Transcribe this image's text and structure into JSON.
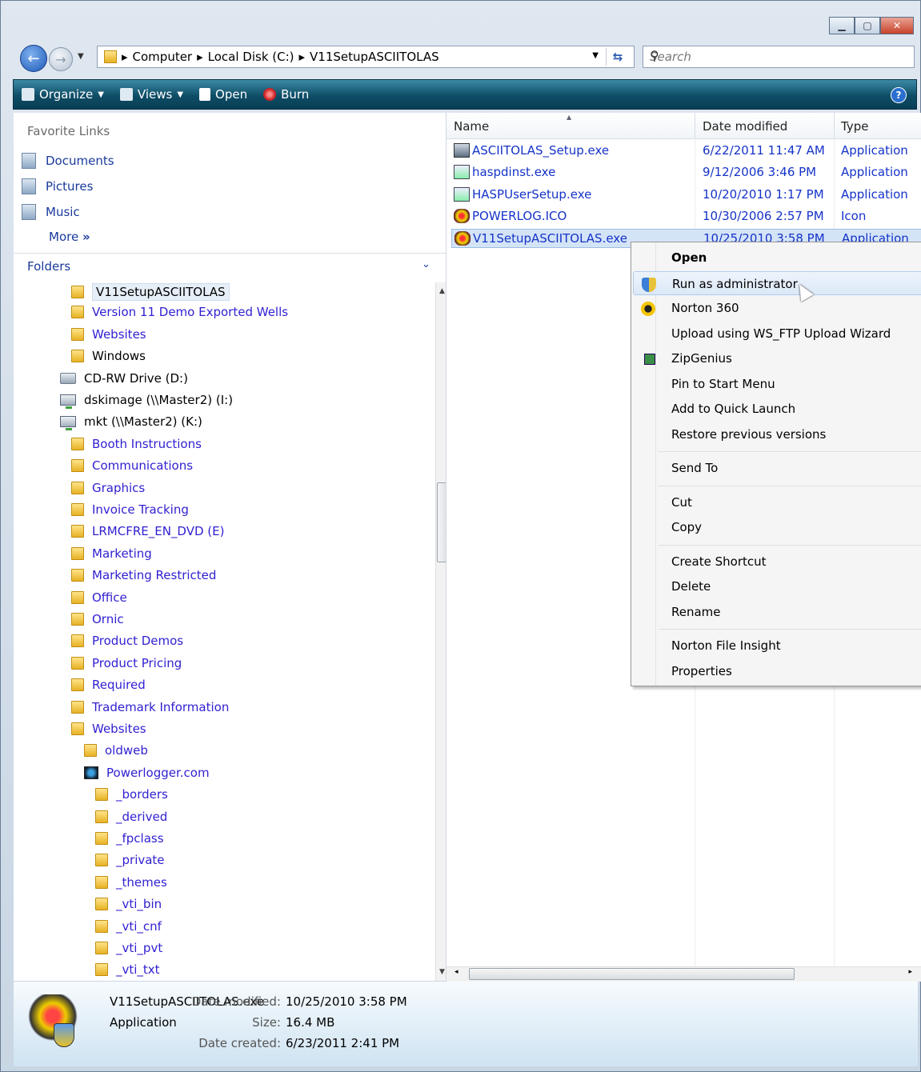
{
  "address": {
    "crumbs": [
      "Computer",
      "Local Disk (C:)",
      "V11SetupASCIITOLAS"
    ],
    "search_placeholder": "Search"
  },
  "toolbar": {
    "organize": "Organize",
    "views": "Views",
    "open": "Open",
    "burn": "Burn"
  },
  "favorites": {
    "title": "Favorite Links",
    "items": [
      "Documents",
      "Pictures",
      "Music"
    ],
    "more": "More"
  },
  "folders": {
    "title": "Folders",
    "items": [
      {
        "label": "V11SetupASCIITOLAS",
        "icon": "folder-icon",
        "indent": 0,
        "selected": true
      },
      {
        "label": "Version 11 Demo Exported Wells",
        "icon": "folder-icon",
        "indent": 0
      },
      {
        "label": "Websites",
        "icon": "folder-icon",
        "indent": 0
      },
      {
        "label": "Windows",
        "icon": "folder-icon",
        "indent": 0
      },
      {
        "label": "CD-RW Drive (D:)",
        "icon": "cd-drive-icon",
        "indent": -1
      },
      {
        "label": "dskimage (\\\\Master2) (I:)",
        "icon": "network-drive-icon",
        "indent": -1
      },
      {
        "label": "mkt (\\\\Master2) (K:)",
        "icon": "network-drive-icon",
        "indent": -1
      },
      {
        "label": "Booth Instructions",
        "icon": "folder-icon",
        "indent": 0
      },
      {
        "label": "Communications",
        "icon": "folder-icon",
        "indent": 0
      },
      {
        "label": "Graphics",
        "icon": "folder-icon",
        "indent": 0
      },
      {
        "label": "Invoice Tracking",
        "icon": "folder-icon",
        "indent": 0
      },
      {
        "label": "LRMCFRE_EN_DVD (E)",
        "icon": "folder-icon",
        "indent": 0
      },
      {
        "label": "Marketing",
        "icon": "folder-icon",
        "indent": 0
      },
      {
        "label": "Marketing Restricted",
        "icon": "folder-icon",
        "indent": 0
      },
      {
        "label": "Office",
        "icon": "folder-icon",
        "indent": 0
      },
      {
        "label": "Ornic",
        "icon": "folder-icon",
        "indent": 0
      },
      {
        "label": "Product Demos",
        "icon": "folder-icon",
        "indent": 0
      },
      {
        "label": "Product Pricing",
        "icon": "folder-icon",
        "indent": 0
      },
      {
        "label": "Required",
        "icon": "folder-icon",
        "indent": 0
      },
      {
        "label": "Trademark Information",
        "icon": "folder-icon",
        "indent": 0
      },
      {
        "label": "Websites",
        "icon": "folder-icon",
        "indent": 0
      },
      {
        "label": "oldweb",
        "icon": "folder-icon",
        "indent": 1
      },
      {
        "label": "Powerlogger.com",
        "icon": "web-folder-icon",
        "indent": 1
      },
      {
        "label": "_borders",
        "icon": "folder-icon",
        "indent": 2
      },
      {
        "label": "_derived",
        "icon": "folder-icon",
        "indent": 2
      },
      {
        "label": "_fpclass",
        "icon": "folder-icon",
        "indent": 2
      },
      {
        "label": "_private",
        "icon": "folder-icon",
        "indent": 2
      },
      {
        "label": "_themes",
        "icon": "folder-icon",
        "indent": 2
      },
      {
        "label": "_vti_bin",
        "icon": "folder-icon",
        "indent": 2
      },
      {
        "label": "_vti_cnf",
        "icon": "folder-icon",
        "indent": 2
      },
      {
        "label": "_vti_pvt",
        "icon": "folder-icon",
        "indent": 2
      },
      {
        "label": "_vti_txt",
        "icon": "folder-icon",
        "indent": 2
      }
    ]
  },
  "columns": {
    "name": "Name",
    "date": "Date modified",
    "type": "Type"
  },
  "files": [
    {
      "name": "ASCIITOLAS_Setup.exe",
      "date": "6/22/2011 11:47 AM",
      "type": "Application",
      "icon": "setup-icon"
    },
    {
      "name": "haspdinst.exe",
      "date": "9/12/2006 3:46 PM",
      "type": "Application",
      "icon": "installer-icon"
    },
    {
      "name": "HASPUserSetup.exe",
      "date": "10/20/2010 1:17 PM",
      "type": "Application",
      "icon": "installer-icon"
    },
    {
      "name": "POWERLOG.ICO",
      "date": "10/30/2006 2:57 PM",
      "type": "Icon",
      "icon": "bug-icon"
    },
    {
      "name": "V11SetupASCIITOLAS.exe",
      "date": "10/25/2010 3:58 PM",
      "type": "Application",
      "icon": "bug-icon",
      "selected": true
    }
  ],
  "context_menu": {
    "groups": [
      [
        {
          "label": "Open",
          "bold": true
        },
        {
          "label": "Run as administrator",
          "icon": "uac-shield-icon",
          "hover": true
        },
        {
          "label": "Norton 360",
          "icon": "norton-icon"
        },
        {
          "label": "Upload using WS_FTP Upload Wizard"
        },
        {
          "label": "ZipGenius",
          "icon": "zipgenius-icon"
        },
        {
          "label": "Pin to Start Menu"
        },
        {
          "label": "Add to Quick Launch"
        },
        {
          "label": "Restore previous versions"
        }
      ],
      [
        {
          "label": "Send To"
        }
      ],
      [
        {
          "label": "Cut"
        },
        {
          "label": "Copy"
        }
      ],
      [
        {
          "label": "Create Shortcut"
        },
        {
          "label": "Delete"
        },
        {
          "label": "Rename"
        }
      ],
      [
        {
          "label": "Norton File Insight"
        },
        {
          "label": "Properties"
        }
      ]
    ]
  },
  "details": {
    "name": "V11SetupASCIITOLAS.exe",
    "type": "Application",
    "date_modified_label": "Date modified:",
    "date_modified": "10/25/2010 3:58 PM",
    "size_label": "Size:",
    "size": "16.4 MB",
    "date_created_label": "Date created:",
    "date_created": "6/23/2011 2:41 PM"
  }
}
